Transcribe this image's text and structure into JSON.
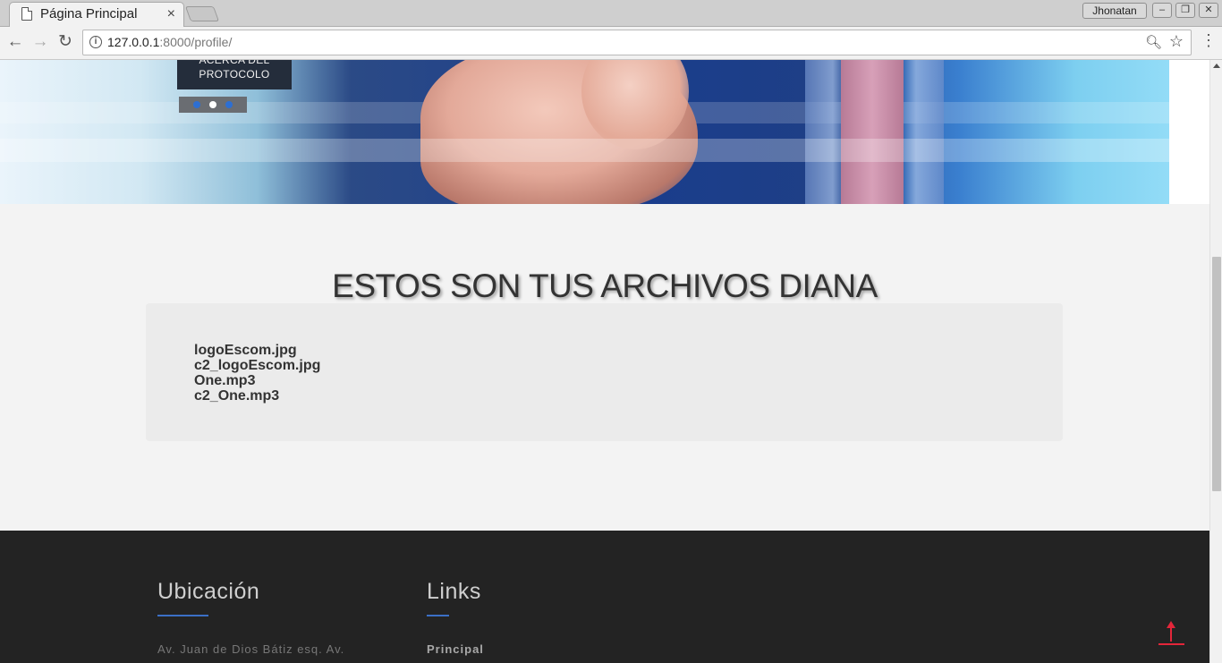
{
  "browser": {
    "tab_title": "Página Principal",
    "tab_close": "×",
    "profile_name": "Jhonatan",
    "url_host": "127.0.0.1",
    "url_rest": ":8000/profile/",
    "window_controls": [
      "–",
      "❐",
      "✕"
    ]
  },
  "hero": {
    "button_line1": "ACERCA DEL",
    "button_line2": "PROTOCOLO",
    "slider_dots": 3,
    "active_dot": 2
  },
  "files": {
    "title": "ESTOS SON TUS ARCHIVOS DIANA",
    "items": [
      "logoEscom.jpg",
      "c2_logoEscom.jpg",
      "One.mp3",
      "c2_One.mp3"
    ]
  },
  "footer": {
    "location_heading": "Ubicación",
    "location_text": "Av. Juan de Dios Bátiz esq. Av.",
    "links_heading": "Links",
    "links_first": "Principal"
  },
  "colors": {
    "accent_blue": "#3b6fc6",
    "scroll_top_red": "#e3263a",
    "footer_bg": "#232323"
  }
}
